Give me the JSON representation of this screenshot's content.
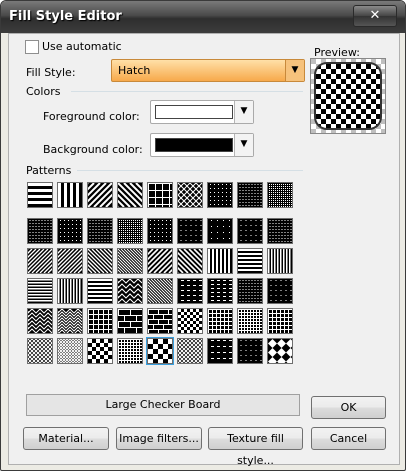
{
  "window": {
    "title": "Fill Style Editor",
    "close_glyph": "✕"
  },
  "use_automatic": {
    "label": "Use automatic",
    "checked": false
  },
  "fill_style": {
    "label": "Fill Style:",
    "value": "Hatch"
  },
  "colors": {
    "group_label": "Colors",
    "foreground": {
      "label": "Foreground color:",
      "value": "#ffffff"
    },
    "background": {
      "label": "Background color:",
      "value": "#000000"
    }
  },
  "preview_label": "Preview:",
  "patterns": {
    "group_label": "Patterns",
    "selected_index": 49,
    "selected_name": "Large Checker Board"
  },
  "buttons": {
    "ok": "OK",
    "material": "Material...",
    "image_filters": "Image filters...",
    "texture_fill": "Texture fill style...",
    "cancel": "Cancel"
  },
  "colors_ui": {
    "accent": "#f7a94b",
    "selection": "#39a0e0"
  }
}
